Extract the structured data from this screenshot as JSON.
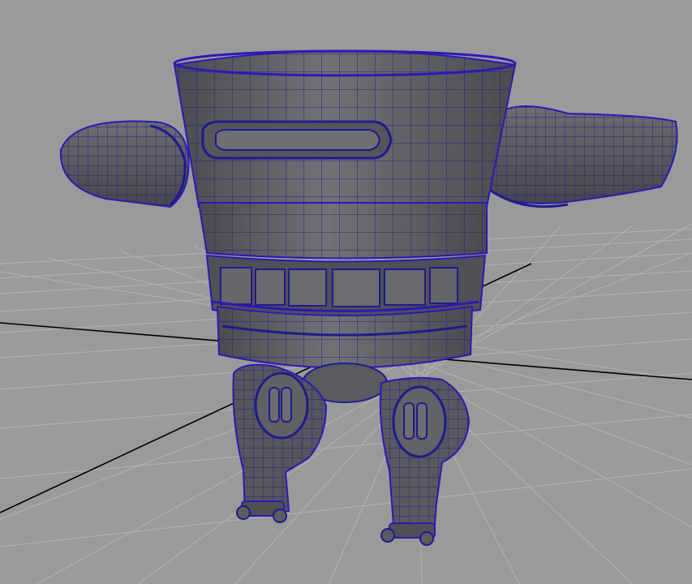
{
  "viewport": {
    "background_color": "#9a9a9a",
    "grid_color": "#b1b1b1",
    "axis_color": "#000000",
    "mesh_fill_dark": "#3e3e46",
    "mesh_fill_mid": "#5e5e63",
    "mesh_fill_light": "#747478",
    "wireframe_color": "#1f1b8c",
    "selected_outline_color": "#2b1ab5"
  },
  "model": {
    "type": "robot-polygon-mesh",
    "display_mode": "shaded-with-wireframe",
    "parts": [
      "torso",
      "left-arm",
      "right-arm",
      "chest-slot",
      "belt-band",
      "left-leg",
      "right-leg",
      "left-foot",
      "right-foot"
    ]
  },
  "icons": {
    "grid": "perspective-grid",
    "axes": "world-axis-lines"
  }
}
